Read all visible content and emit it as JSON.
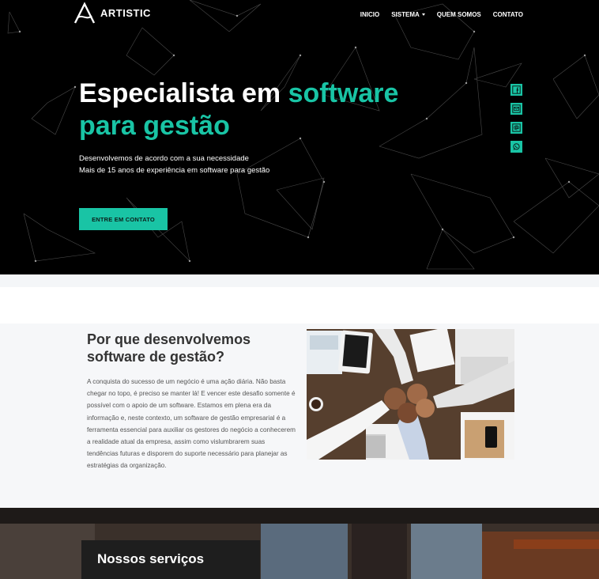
{
  "brand": {
    "name": "ARTISTIC"
  },
  "nav": {
    "items": [
      {
        "label": "INICIO"
      },
      {
        "label": "SISTEMA",
        "has_dropdown": true
      },
      {
        "label": "QUEM SOMOS"
      },
      {
        "label": "CONTATO"
      }
    ]
  },
  "hero": {
    "title_part1": "Especialista em ",
    "title_accent1": "software",
    "title_accent2": "para gestão",
    "subtitle_line1": "Desenvolvemos de acordo com a sua necessidade",
    "subtitle_line2": "Mais de 15 anos de experiência em software para gestão",
    "cta_label": "ENTRE EM CONTATO"
  },
  "social": {
    "icons": [
      "facebook-icon",
      "mail-icon",
      "at-icon",
      "whatsapp-icon"
    ]
  },
  "about": {
    "title": "Por que desenvolvemos software de gestão?",
    "text": "A conquista do sucesso de um negócio é uma ação diária. Não basta chegar no topo, é preciso se manter lá! E vencer este desafio somente é possível com o apoio de um software. Estamos em plena era da informação e, neste contexto, um software de gestão empresarial é a ferramenta essencial para auxiliar os gestores do negócio a conhecerem a realidade atual da empresa, assim como vislumbrarem suas tendências futuras e disporem do suporte necessário para planejar as estratégias da organização."
  },
  "services": {
    "title": "Nossos serviços"
  },
  "colors": {
    "accent": "#19c4a5",
    "hero_bg": "#000000",
    "about_bg": "#f6f7f9",
    "services_box": "#1e1e1e"
  }
}
